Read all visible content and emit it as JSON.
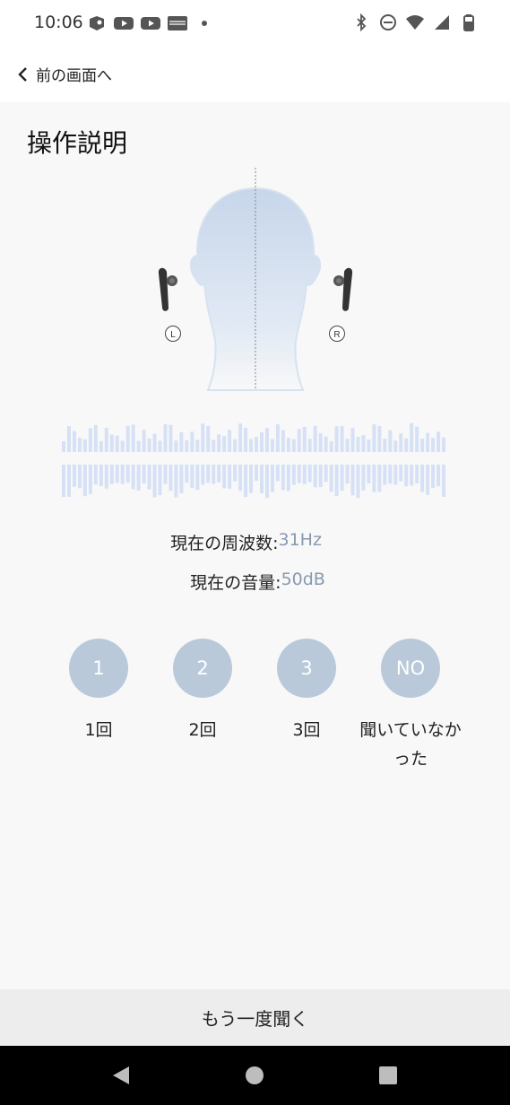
{
  "status_bar": {
    "time": "10:06",
    "notification_icons": [
      "nfc-tag-icon",
      "youtube-icon",
      "youtube-icon",
      "app-image-icon",
      "more-dot-icon"
    ],
    "system_icons": [
      "bluetooth-icon",
      "do-not-disturb-icon",
      "wifi-icon",
      "cell-signal-icon",
      "battery-icon"
    ]
  },
  "header": {
    "back_label": "前の画面へ"
  },
  "page": {
    "title": "操作説明"
  },
  "illustration": {
    "left_marker": "L",
    "right_marker": "R"
  },
  "info": {
    "frequency_label": "現在の周波数:",
    "frequency_value": "31Hz",
    "volume_label": "現在の音量:",
    "volume_value": "50dB"
  },
  "answers": [
    {
      "circle": "1",
      "label": "1回"
    },
    {
      "circle": "2",
      "label": "2回"
    },
    {
      "circle": "3",
      "label": "3回"
    },
    {
      "circle": "NO",
      "label": "聞いていなかった"
    }
  ],
  "footer": {
    "replay_label": "もう一度聞く"
  },
  "colors": {
    "accent_circle": "#b9c9da",
    "value_text": "#8899b0",
    "waveform": "#d6e1f6"
  }
}
